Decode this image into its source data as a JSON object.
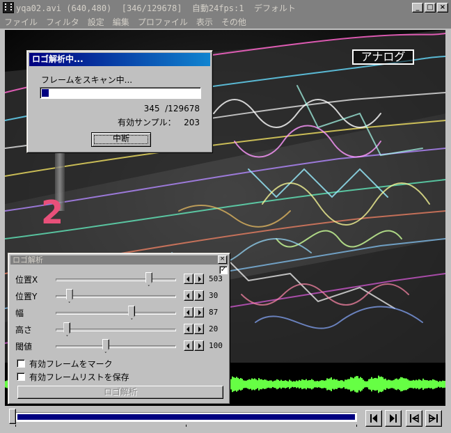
{
  "window": {
    "title": "yqa02.avi (640,480)  [346/129678]  自動24fps:1  デフォルト",
    "minimize_glyph": "_",
    "maximize_glyph": "□",
    "close_glyph": "×"
  },
  "menu": [
    "ファイル",
    "フィルタ",
    "設定",
    "編集",
    "プロファイル",
    "表示",
    "その他"
  ],
  "video": {
    "overlay_tag": "アナログ",
    "channel_number": "2"
  },
  "progress_dialog": {
    "title": "ロゴ解析中...",
    "status": "フレームをスキャン中...",
    "progress_fraction": 0.0027,
    "frame_count": "345  /129678",
    "samples_text": "有効サンプル：   203",
    "abort_label": "中断"
  },
  "logo_tool": {
    "title": "ロゴ解析",
    "close_glyph": "×",
    "top_checkbox_checked": true,
    "top_checkbox_glyph": "✓",
    "params": [
      {
        "label": "位置X",
        "value": "503",
        "fraction": 0.79
      },
      {
        "label": "位置Y",
        "value": "30",
        "fraction": 0.09
      },
      {
        "label": "幅",
        "value": "87",
        "fraction": 0.64
      },
      {
        "label": "高さ",
        "value": "20",
        "fraction": 0.07
      },
      {
        "label": "閾値",
        "value": "100",
        "fraction": 0.41
      }
    ],
    "checkboxes": [
      {
        "label": "有効フレームをマーク",
        "checked": false
      },
      {
        "label": "有効フレームリストを保存",
        "checked": false
      }
    ],
    "analyze_label": "ロゴ解析"
  },
  "seek": {
    "position_fraction": 0.0027
  },
  "transport": {
    "buttons": [
      "prev-frame-icon",
      "next-frame-icon",
      "prev-keyframe-icon",
      "next-keyframe-icon"
    ]
  },
  "colors": {
    "waveform": "#66ff44",
    "progress": "#000080",
    "title_active": "#000080"
  }
}
